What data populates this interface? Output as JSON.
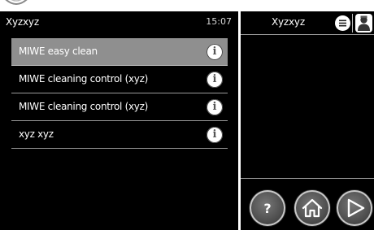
{
  "header": {
    "title": "Xyzxyz",
    "time": "15:07"
  },
  "programs": [
    {
      "label": "MIWE easy clean",
      "selected": true
    },
    {
      "label": "MIWE cleaning control (xyz)",
      "selected": false
    },
    {
      "label": "MIWE cleaning control (xyz)",
      "selected": false
    },
    {
      "label": "xyz xyz",
      "selected": false
    }
  ],
  "right_panel": {
    "title": "Xyzxyz"
  },
  "icons": {
    "info": "i",
    "help": "?",
    "home": "home-icon",
    "play": "play-icon",
    "menu": "menu-icon",
    "user": "user-icon"
  },
  "colors": {
    "panel_bg": "#000000",
    "selected_row": "#8f8f8f",
    "button_gray": "#505050"
  }
}
